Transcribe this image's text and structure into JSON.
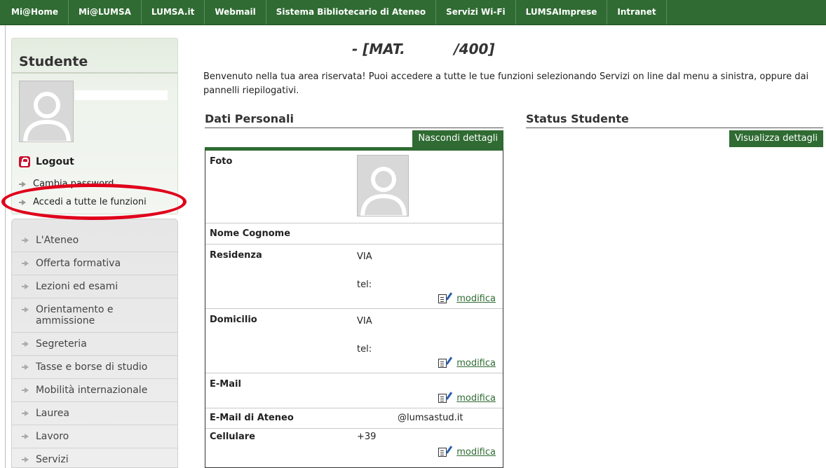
{
  "topnav": [
    "Mi@Home",
    "Mi@LUMSA",
    "LUMSA.it",
    "Webmail",
    "Sistema Bibliotecario di Ateneo",
    "Servizi Wi-Fi",
    "LUMSAImprese",
    "Intranet"
  ],
  "sidebar": {
    "title": "Studente",
    "logout": "Logout",
    "change_password": "Cambia password",
    "all_functions": "Accedi a tutte le funzioni",
    "menu": [
      "L'Ateneo",
      "Offerta formativa",
      "Lezioni ed esami",
      "Orientamento e ammissione",
      "Segreteria",
      "Tasse e borse di studio",
      "Mobilità internazionale",
      "Laurea",
      "Lavoro",
      "Servizi"
    ]
  },
  "main": {
    "title": "- [MAT.          /400]",
    "intro": "Benvenuto nella tua area riservata! Puoi accedere a tutte le tue funzioni selezionando Servizi on line dal menu a sinistra, oppure dai pannelli riepilogativi.",
    "dati_title": "Dati Personali",
    "hide_btn": "Nascondi dettagli",
    "status_title": "Status Studente",
    "show_btn": "Visualizza dettagli",
    "edit_label": "modifica",
    "rows": {
      "foto": "Foto",
      "nome": "Nome Cognome",
      "residenza": "Residenza",
      "residenza_via": "VIA",
      "residenza_tel": "tel:",
      "domicilio": "Domicilio",
      "domicilio_via": "VIA",
      "domicilio_tel": "tel:",
      "email": "E-Mail",
      "email_ateneo": "E-Mail di Ateneo",
      "email_ateneo_value": "@lumsastud.it",
      "cellulare": "Cellulare",
      "cellulare_value": "+39"
    }
  },
  "colors": {
    "brand_green": "#2f6b32",
    "highlight_red": "#e0001b"
  }
}
